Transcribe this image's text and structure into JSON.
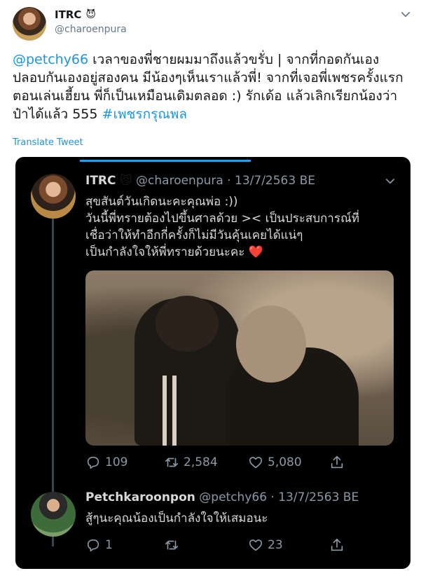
{
  "tweet": {
    "author_name": "ITRC",
    "author_emoji": "😈",
    "handle": "@charoenpura",
    "text_mention": "@petchy66",
    "text_body": " เวลาของพี่ชายผมมาถึงแล้วขรั่บ | จากที่กอดกันเอง ปลอบกันเองอยู่สองคน มีน้องๆเห็นเราแล้วพี่! จากที่เจอพี่เพชรครั้งแรกตอนเล่นเฮี้ยน พี่ก็เป็นเหมือนเดิมตลอด :) รักเด้อ แล้วเลิกเรียกน้องว่าป๋าได้แล้ว 555 ",
    "text_hashtag": "#เพชรกรุณพล",
    "translate_label": "Translate Tweet"
  },
  "embedded": {
    "first": {
      "name": "ITRC",
      "emoji": "😼",
      "meta": "@charoenpura · 13/7/2563 BE",
      "lines": [
        "สุขสันต์วันเกิดนะคะคุณพ่อ :))",
        "วันนี้พี่ทรายต้องไปขึ้นศาลด้วย >< เป็นประสบการณ์ที่",
        "เชื่อว่าให้ทำอีกกี่ครั้งก็ไม่มีวันคุ้นเคยได้แน่ๆ",
        "เป็นกำลังใจให้พี่ทรายด้วยนะคะ ❤️"
      ],
      "replies": "109",
      "retweets": "2,584",
      "likes": "5,080"
    },
    "second": {
      "name": "Petchkaroonpon",
      "meta": "@petchy66 · 13/7/2563 BE",
      "text": "สู้ๆนะคุณน้องเป็นกำลังใจให้เสมอนะ",
      "replies": "1",
      "retweets": "",
      "likes": "23"
    }
  },
  "icons": {
    "chevron": "chevron-down-icon",
    "reply": "reply-icon",
    "retweet": "retweet-icon",
    "like": "heart-icon",
    "share": "share-icon"
  },
  "colors": {
    "link": "#1b95e0",
    "dark_bg": "#000000",
    "dark_text": "#d9d9d9",
    "dark_meta": "#8899a6"
  }
}
